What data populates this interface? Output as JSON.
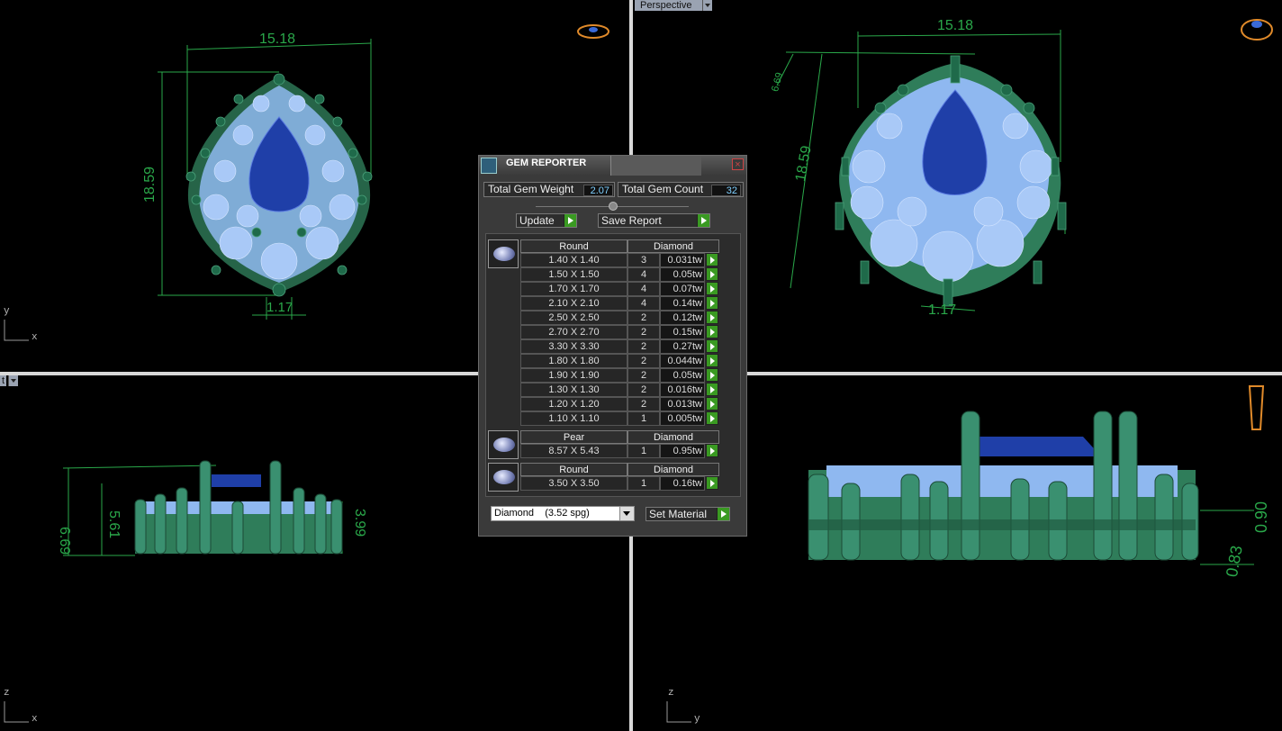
{
  "viewports": {
    "top_left": {
      "dim_width": "15.18",
      "dim_height": "18.59",
      "dim_small": "1.17",
      "axis_v": "y",
      "axis_h": "x"
    },
    "top_right": {
      "tab_label": "Perspective",
      "dim_width": "15.18",
      "dim_height": "18.59",
      "dim_a": "6.69",
      "dim_b": "1.17"
    },
    "bottom_left": {
      "tab_label": "t",
      "dim_a": "6.69",
      "dim_b": "5.61",
      "dim_c": "3.99",
      "axis_v": "z",
      "axis_h": "x"
    },
    "bottom_right": {
      "dim_a": "0.90",
      "dim_b": "0.83",
      "axis_v": "z",
      "axis_h": "y"
    }
  },
  "gem_reporter": {
    "title": "GEM REPORTER",
    "close_symbol": "×",
    "total_weight_label": "Total Gem Weight",
    "total_weight_value": "2.07",
    "total_count_label": "Total Gem Count",
    "total_count_value": "32",
    "update_label": "Update",
    "save_report_label": "Save Report",
    "groups": [
      {
        "shape": "Round",
        "material": "Diamond",
        "rows": [
          {
            "size": "1.40 X 1.40",
            "count": "3",
            "weight": "0.031tw"
          },
          {
            "size": "1.50 X 1.50",
            "count": "4",
            "weight": "0.05tw"
          },
          {
            "size": "1.70 X 1.70",
            "count": "4",
            "weight": "0.07tw"
          },
          {
            "size": "2.10 X 2.10",
            "count": "4",
            "weight": "0.14tw"
          },
          {
            "size": "2.50 X 2.50",
            "count": "2",
            "weight": "0.12tw"
          },
          {
            "size": "2.70 X 2.70",
            "count": "2",
            "weight": "0.15tw"
          },
          {
            "size": "3.30 X 3.30",
            "count": "2",
            "weight": "0.27tw"
          },
          {
            "size": "1.80 X 1.80",
            "count": "2",
            "weight": "0.044tw"
          },
          {
            "size": "1.90 X 1.90",
            "count": "2",
            "weight": "0.05tw"
          },
          {
            "size": "1.30 X 1.30",
            "count": "2",
            "weight": "0.016tw"
          },
          {
            "size": "1.20 X 1.20",
            "count": "2",
            "weight": "0.013tw"
          },
          {
            "size": "1.10 X 1.10",
            "count": "1",
            "weight": "0.005tw"
          }
        ]
      },
      {
        "shape": "Pear",
        "material": "Diamond",
        "rows": [
          {
            "size": "8.57 X 5.43",
            "count": "1",
            "weight": "0.95tw"
          }
        ]
      },
      {
        "shape": "Round",
        "material": "Diamond",
        "rows": [
          {
            "size": "3.50 X 3.50",
            "count": "1",
            "weight": "0.16tw"
          }
        ]
      }
    ],
    "material_select_value": "Diamond    (3.52 spg)",
    "set_material_label": "Set Material"
  },
  "colors": {
    "metal": "#2f7d5a",
    "gem_light": "#8fb8f0",
    "gem_center": "#1f3fa8",
    "dimension": "#2aa84a"
  }
}
